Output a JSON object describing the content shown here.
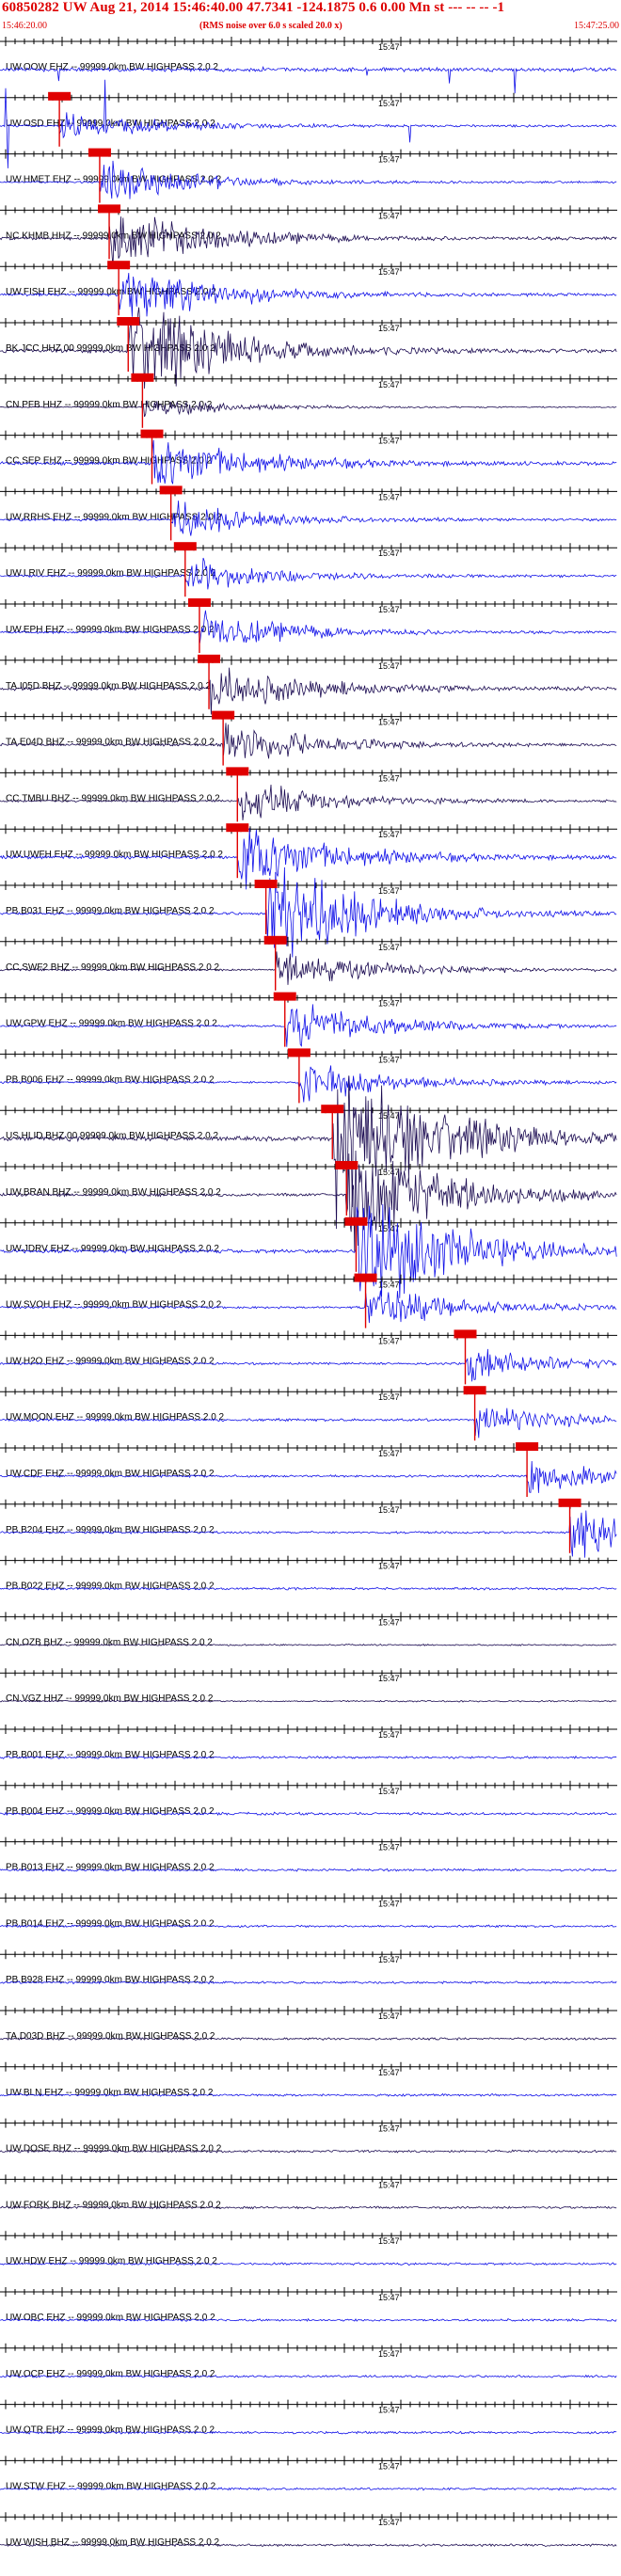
{
  "header": {
    "title": "60850282 UW Aug 21, 2014 15:46:40.00   47.7341 -124.1875  0.6 0.00 Mn st --- -- --  -1",
    "subtitle": "(RMS noise over 6.0 s scaled 20.0 x)",
    "start_time": "15:46:20.00",
    "end_time": "15:47:25.00",
    "title_color": "#dd0000"
  },
  "colors": {
    "blue_trace": "#1010e8",
    "dark_trace": "#1c0c52",
    "pick": "#e00000",
    "grid": "#000000"
  },
  "chart_data": {
    "type": "seismogram",
    "title": "60850282 UW Aug 21, 2014 15:46:40.00   47.7341 -124.1875  0.6 0.00 Mn st --- -- --  -1",
    "x_range": [
      "15:46:20.00",
      "15:47:25.00"
    ],
    "tick_label": "15:47",
    "grid": true,
    "traces": [
      {
        "label": "UW.OOW EHZ -- 99999.0km BW  HIGHPASS  2.0  2",
        "color": "blue",
        "amp": 0.5,
        "burst": 0.0,
        "pick": null
      },
      {
        "label": "UW.OSD EHZ -- 99999.0km BW  HIGHPASS  2.0  2",
        "color": "blue",
        "amp": 0.3,
        "burst": 0.6,
        "pick": 0.0962
      },
      {
        "label": "UW.HMET EHZ -- 99999.0km BW  HIGHPASS  2.0  2",
        "color": "blue",
        "amp": 0.25,
        "burst": 0.9,
        "pick": 0.1615
      },
      {
        "label": "NC.KHMB HHZ -- 99999.0km BW  HIGHPASS  2.0  2",
        "color": "dark",
        "amp": 0.4,
        "burst": 1.4,
        "pick": 0.1769
      },
      {
        "label": "UW.FISH EHZ -- 99999.0km BW  HIGHPASS  2.0  2",
        "color": "blue",
        "amp": 0.35,
        "burst": 1.3,
        "pick": 0.1923
      },
      {
        "label": "BK.JCC HHZ 00 99999.0km BW  HIGHPASS  2.0  2",
        "color": "dark",
        "amp": 0.5,
        "burst": 2.0,
        "pick": 0.2077
      },
      {
        "label": "CN.PFB HHZ -- 99999.0km BW  HIGHPASS  2.0  2",
        "color": "dark",
        "amp": 0.15,
        "burst": 0.4,
        "pick": 0.2308
      },
      {
        "label": "CC.SEP EHZ -- 99999.0km BW  HIGHPASS  2.0  2",
        "color": "blue",
        "amp": 0.45,
        "burst": 1.2,
        "pick": 0.2462
      },
      {
        "label": "UW.RRHS EHZ -- 99999.0km BW  HIGHPASS  2.0  2",
        "color": "blue",
        "amp": 0.3,
        "burst": 0.7,
        "pick": 0.2769
      },
      {
        "label": "UW.LRIV EHZ -- 99999.0km BW  HIGHPASS  2.0  2",
        "color": "blue",
        "amp": 0.3,
        "burst": 0.7,
        "pick": 0.3
      },
      {
        "label": "UW.EPH EHZ -- 99999.0km BW  HIGHPASS  2.0  2",
        "color": "blue",
        "amp": 0.3,
        "burst": 0.8,
        "pick": 0.3231
      },
      {
        "label": "TA.I05D BHZ -- 99999.0km BW  HIGHPASS  2.0  2",
        "color": "dark",
        "amp": 0.45,
        "burst": 1.0,
        "pick": 0.3385
      },
      {
        "label": "TA.E04D BHZ -- 99999.0km BW  HIGHPASS  2.0  2",
        "color": "dark",
        "amp": 0.35,
        "burst": 0.9,
        "pick": 0.3615
      },
      {
        "label": "CC.TMBU BHZ -- 99999.0km BW  HIGHPASS  2.0  2",
        "color": "dark",
        "amp": 0.3,
        "burst": 0.8,
        "pick": 0.3846
      },
      {
        "label": "UW.UWFH EHZ -- 99999.0km BW  HIGHPASS  2.0  2",
        "color": "blue",
        "amp": 0.45,
        "burst": 1.4,
        "pick": 0.3846
      },
      {
        "label": "PB.B031 EHZ -- 99999.0km BW  HIGHPASS  2.0  2",
        "color": "blue",
        "amp": 0.35,
        "burst": 2.2,
        "pick": 0.4308
      },
      {
        "label": "CC.SWF2 BHZ -- 99999.0km BW  HIGHPASS  2.0  2",
        "color": "dark",
        "amp": 0.3,
        "burst": 0.8,
        "pick": 0.4462
      },
      {
        "label": "UW.GPW EHZ -- 99999.0km BW  HIGHPASS  2.0  2",
        "color": "blue",
        "amp": 0.3,
        "burst": 1.0,
        "pick": 0.4615
      },
      {
        "label": "PB.B006 EHZ -- 99999.0km BW  HIGHPASS  2.0  2",
        "color": "blue",
        "amp": 0.3,
        "burst": 0.8,
        "pick": 0.4846
      },
      {
        "label": "US.HLID BHZ 00 99999.0km BW  HIGHPASS  2.0  2",
        "color": "dark",
        "amp": 0.6,
        "burst": 3.5,
        "pick": 0.5385
      },
      {
        "label": "UW.BRAN BHZ -- 99999.0km BW  HIGHPASS  2.0  2",
        "color": "dark",
        "amp": 0.4,
        "burst": 2.5,
        "pick": 0.5615
      },
      {
        "label": "UW.JDRV EHZ -- 99999.0km BW  HIGHPASS  2.0  2",
        "color": "blue",
        "amp": 0.5,
        "burst": 2.8,
        "pick": 0.5769
      },
      {
        "label": "UW.SVOH EHZ -- 99999.0km BW  HIGHPASS  2.0  2",
        "color": "blue",
        "amp": 0.3,
        "burst": 0.9,
        "pick": 0.5923
      },
      {
        "label": "UW.H2O EHZ -- 99999.0km BW  HIGHPASS  2.0  2",
        "color": "blue",
        "amp": 0.3,
        "burst": 0.6,
        "pick": 0.7538
      },
      {
        "label": "UW.MOON EHZ -- 99999.0km BW  HIGHPASS  2.0  2",
        "color": "blue",
        "amp": 0.35,
        "burst": 0.6,
        "pick": 0.7692
      },
      {
        "label": "UW.CDF EHZ -- 99999.0km BW  HIGHPASS  2.0  2",
        "color": "blue",
        "amp": 0.3,
        "burst": 0.7,
        "pick": 0.8538
      },
      {
        "label": "PB.B204 EHZ -- 99999.0km BW  HIGHPASS  2.0  2",
        "color": "blue",
        "amp": 0.3,
        "burst": 1.2,
        "pick": 0.9231
      },
      {
        "label": "PB.B022 EHZ -- 99999.0km BW  HIGHPASS  2.0  2",
        "color": "blue",
        "amp": 0.3,
        "burst": 0.5,
        "pick": null
      },
      {
        "label": "CN.OZB BHZ -- 99999.0km BW  HIGHPASS  2.0  2",
        "color": "dark",
        "amp": 0.2,
        "burst": 0.2,
        "pick": null
      },
      {
        "label": "CN.VGZ HHZ -- 99999.0km BW  HIGHPASS  2.0  2",
        "color": "dark",
        "amp": 0.2,
        "burst": 0.2,
        "pick": null
      },
      {
        "label": "PB.B001 EHZ -- 99999.0km BW  HIGHPASS  2.0  2",
        "color": "blue",
        "amp": 0.3,
        "burst": 0.3,
        "pick": null
      },
      {
        "label": "PB.B004 EHZ -- 99999.0km BW  HIGHPASS  2.0  2",
        "color": "blue",
        "amp": 0.35,
        "burst": 0.5,
        "pick": null
      },
      {
        "label": "PB.B013 EHZ -- 99999.0km BW  HIGHPASS  2.0  2",
        "color": "blue",
        "amp": 0.3,
        "burst": 0.2,
        "pick": null
      },
      {
        "label": "PB.B014 EHZ -- 99999.0km BW  HIGHPASS  2.0  2",
        "color": "blue",
        "amp": 0.3,
        "burst": 0.2,
        "pick": null
      },
      {
        "label": "PB.B928 EHZ -- 99999.0km BW  HIGHPASS  2.0  2",
        "color": "blue",
        "amp": 0.3,
        "burst": 0.2,
        "pick": null
      },
      {
        "label": "TA.D03D BHZ -- 99999.0km BW  HIGHPASS  2.0  2",
        "color": "dark",
        "amp": 0.3,
        "burst": 0.2,
        "pick": null
      },
      {
        "label": "UW.BLN EHZ -- 99999.0km BW  HIGHPASS  2.0  2",
        "color": "blue",
        "amp": 0.3,
        "burst": 0.2,
        "pick": null
      },
      {
        "label": "UW.DOSE BHZ -- 99999.0km BW  HIGHPASS  2.0  2",
        "color": "dark",
        "amp": 0.3,
        "burst": 0.2,
        "pick": null
      },
      {
        "label": "UW.FORK BHZ -- 99999.0km BW  HIGHPASS  2.0  2",
        "color": "dark",
        "amp": 0.3,
        "burst": 0.2,
        "pick": null
      },
      {
        "label": "UW.HDW EHZ -- 99999.0km BW  HIGHPASS  2.0  2",
        "color": "blue",
        "amp": 0.3,
        "burst": 0.2,
        "pick": null
      },
      {
        "label": "UW.OBC EHZ -- 99999.0km BW  HIGHPASS  2.0  2",
        "color": "blue",
        "amp": 0.3,
        "burst": 0.2,
        "pick": null
      },
      {
        "label": "UW.OCP EHZ -- 99999.0km BW  HIGHPASS  2.0  2",
        "color": "blue",
        "amp": 0.3,
        "burst": 0.2,
        "pick": null
      },
      {
        "label": "UW.OTR EHZ -- 99999.0km BW  HIGHPASS  2.0  2",
        "color": "blue",
        "amp": 0.3,
        "burst": 0.2,
        "pick": null
      },
      {
        "label": "UW.STW EHZ -- 99999.0km BW  HIGHPASS  2.0  2",
        "color": "blue",
        "amp": 0.3,
        "burst": 0.2,
        "pick": null
      },
      {
        "label": "UW.WISH BHZ -- 99999.0km BW  HIGHPASS  2.0  2",
        "color": "dark",
        "amp": 0.3,
        "burst": 0.2,
        "pick": null
      }
    ]
  }
}
